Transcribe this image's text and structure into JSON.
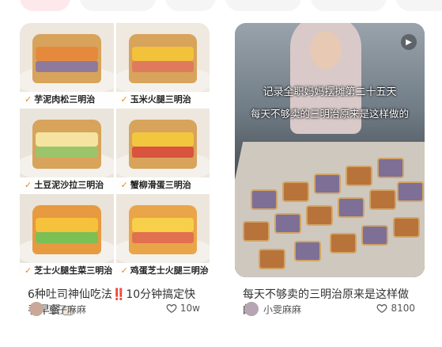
{
  "cards": [
    {
      "cover_labels": [
        "芋泥肉松三明治",
        "玉米火腿三明治",
        "土豆泥沙拉三明治",
        "蟹柳滑蛋三明治",
        "芝士火腿生菜三明治",
        "鸡蛋芝士火腿三明治"
      ],
      "title": "6种吐司神仙吃法‼️10分钟搞定快手早餐",
      "author": "豆子麻麻",
      "likes": "10w"
    },
    {
      "cover_text_1": "记录全职妈妈摆摊第二十五天",
      "cover_text_2": "每天不够卖的三明治原来是这样做的",
      "title": "每天不够卖的三明治原来是这样做的",
      "author": "小雯麻麻",
      "likes": "8100"
    }
  ],
  "icons": {
    "like": "heart-outline-icon",
    "check": "check-icon",
    "video": "play-icon",
    "title_emoji": "rice-bowl-icon"
  },
  "colors": {
    "active_chip": "#fde9ec",
    "chip": "#f5f5f5",
    "check": "#e3892c",
    "text": "#333333"
  }
}
